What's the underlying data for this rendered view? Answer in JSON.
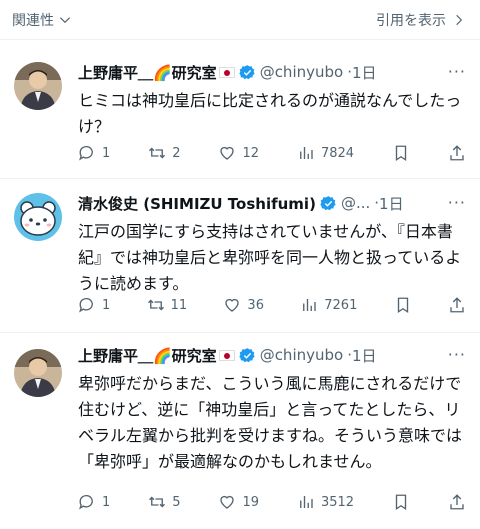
{
  "topbar": {
    "sort_label": "関連性",
    "quotes_label": "引用を表示"
  },
  "tweets": [
    {
      "name": "上野庸平＿🌈研究室",
      "handle": "@chinyubo",
      "time": "1日",
      "text": "ヒミコは神功皇后に比定されるのが通説なんでしたっけ？",
      "replies": "1",
      "reposts": "2",
      "likes": "12",
      "views": "7824"
    },
    {
      "name": "清水俊史 (SHIMIZU Toshifumi)",
      "handle": "@...",
      "time": "1日",
      "text": "江戸の国学にすら支持はされていませんが、『日本書紀』では神功皇后と卑弥呼を同一人物と扱っているように読めます。",
      "replies": "1",
      "reposts": "11",
      "likes": "36",
      "views": "7261"
    },
    {
      "name": "上野庸平＿🌈研究室",
      "handle": "@chinyubo",
      "time": "1日",
      "text": "卑弥呼だからまだ、こういう風に馬鹿にされるだけで住むけど、逆に「神功皇后」と言ってたとしたら、リベラル左翼から批判を受けますね。そういう意味では「卑弥呼」が最適解なのかもしれません。",
      "replies": "1",
      "reposts": "5",
      "likes": "19",
      "views": "3512"
    }
  ]
}
